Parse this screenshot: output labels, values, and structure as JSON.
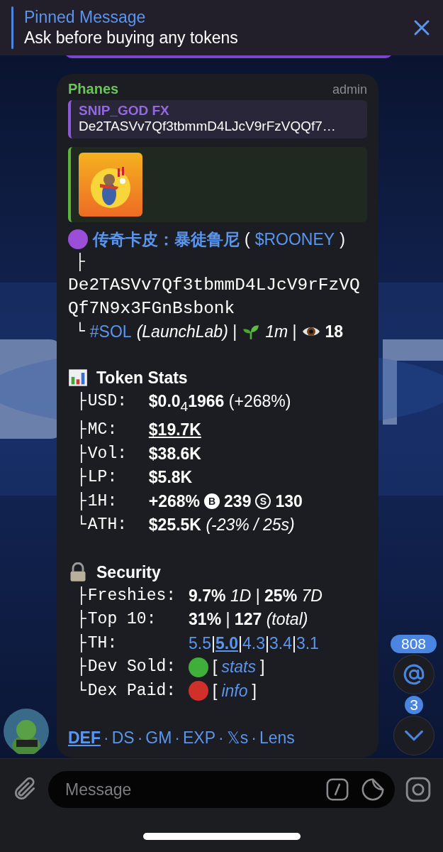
{
  "pinned": {
    "title": "Pinned Message",
    "text": "Ask before buying any tokens"
  },
  "message": {
    "sender": "Phanes",
    "role": "admin",
    "reply": {
      "author": "SNIP_GOD FX",
      "text": "De2TASVv7Qf3tbmmD4LJcV9rFzVQQf7…"
    },
    "lines": [
      {
        "parts": [
          {
            "kind": "dot",
            "color": "#9b4fd8"
          },
          {
            "kind": "title-link",
            "text": "传奇卡皮：暴徒鲁尼"
          },
          {
            "kind": "text",
            "text": "("
          },
          {
            "kind": "link",
            "text": "$ROONEY"
          },
          {
            "kind": "text",
            "text": ")"
          }
        ]
      },
      {
        "parts": [
          {
            "kind": "mono",
            "text": "├"
          }
        ]
      },
      {
        "parts": [
          {
            "kind": "address",
            "text": "De2TASVv7Qf3tbmmD4LJcV9rFzVQQf7N9x3FGnBsbonk"
          }
        ]
      },
      {
        "parts": [
          {
            "kind": "mono",
            "text": "└"
          },
          {
            "kind": "link",
            "text": "#SOL"
          },
          {
            "kind": "text",
            "text": "*(LaunchLab)* |"
          },
          {
            "kind": "sprout"
          },
          {
            "kind": "text",
            "text": "*1m* |"
          },
          {
            "kind": "eye"
          },
          {
            "kind": "text",
            "text": "**18**"
          }
        ]
      }
    ],
    "sections": [
      {
        "kind": "chart",
        "title": "Token Stats",
        "rows": [
          {
            "branch": "├",
            "label": "USD:",
            "parts": [
              {
                "kind": "text",
                "text": "**$0.0**$_{4}$**1966** (+268%)"
              }
            ]
          },
          {
            "branch": "├",
            "label": "MC:",
            "parts": [
              {
                "kind": "value-link",
                "text": "$19.7K"
              }
            ]
          },
          {
            "branch": "├",
            "label": "Vol:",
            "parts": [
              {
                "kind": "text",
                "text": "**$38.6K**"
              }
            ]
          },
          {
            "branch": "├",
            "label": "LP:",
            "parts": [
              {
                "kind": "text",
                "text": "**$5.8K**"
              }
            ]
          },
          {
            "branch": "├",
            "label": "1H:",
            "parts": [
              {
                "kind": "text",
                "text": "**+268%**"
              },
              {
                "kind": "coin",
                "text": "B",
                "filled": true
              },
              {
                "kind": "text",
                "text": "**239**"
              },
              {
                "kind": "coin",
                "text": "S",
                "filled": false
              },
              {
                "kind": "text",
                "text": "**130**"
              }
            ]
          },
          {
            "branch": "└",
            "label": "ATH:",
            "parts": [
              {
                "kind": "text",
                "text": "**$25.5K** *(-23% / 25s)*"
              }
            ]
          }
        ]
      },
      {
        "kind": "lock",
        "title": "Security",
        "rows": [
          {
            "branch": "├",
            "label": "Freshies:",
            "parts": [
              {
                "kind": "text",
                "text": "**9.7%** *1D* | **25%** *7D*"
              }
            ]
          },
          {
            "branch": "├",
            "label": "Top 10:",
            "parts": [
              {
                "kind": "text",
                "text": "**31%** | **127** *(total)*"
              }
            ]
          },
          {
            "branch": "├",
            "label": "TH:",
            "parts": [
              {
                "kind": "link",
                "text": "5.5"
              },
              {
                "kind": "text",
                "text": "|"
              },
              {
                "kind": "strong-link",
                "text": "5.0"
              },
              {
                "kind": "text",
                "text": "|"
              },
              {
                "kind": "link",
                "text": "4.3"
              },
              {
                "kind": "text",
                "text": "|"
              },
              {
                "kind": "link",
                "text": "3.4"
              },
              {
                "kind": "text",
                "text": "|"
              },
              {
                "kind": "link",
                "text": "3.1"
              }
            ]
          },
          {
            "branch": "├",
            "label": "Dev Sold:",
            "parts": [
              {
                "kind": "dot",
                "color": "#3fae3a"
              },
              {
                "kind": "text",
                "text": "["
              },
              {
                "kind": "link",
                "text": "*stats*"
              },
              {
                "kind": "text",
                "text": "]"
              }
            ]
          },
          {
            "branch": "└",
            "label": "Dex Paid:",
            "parts": [
              {
                "kind": "dot",
                "color": "#d0302a"
              },
              {
                "kind": "text",
                "text": "["
              },
              {
                "kind": "link",
                "text": "*info*"
              },
              {
                "kind": "text",
                "text": "]"
              }
            ]
          }
        ]
      }
    ],
    "footer": {
      "separator": "·",
      "links": [
        {
          "text": "DEF",
          "underlined": true
        },
        {
          "text": "DS",
          "underlined": false
        },
        {
          "text": "GM",
          "underlined": false
        },
        {
          "text": "EXP",
          "underlined": false
        },
        {
          "text": "𝕏s",
          "underlined": false
        },
        {
          "text": "Lens",
          "underlined": false
        }
      ]
    }
  },
  "mentions": {
    "count": "808"
  },
  "scroll_down": {
    "count": "3"
  },
  "composer": {
    "placeholder": "Message"
  }
}
